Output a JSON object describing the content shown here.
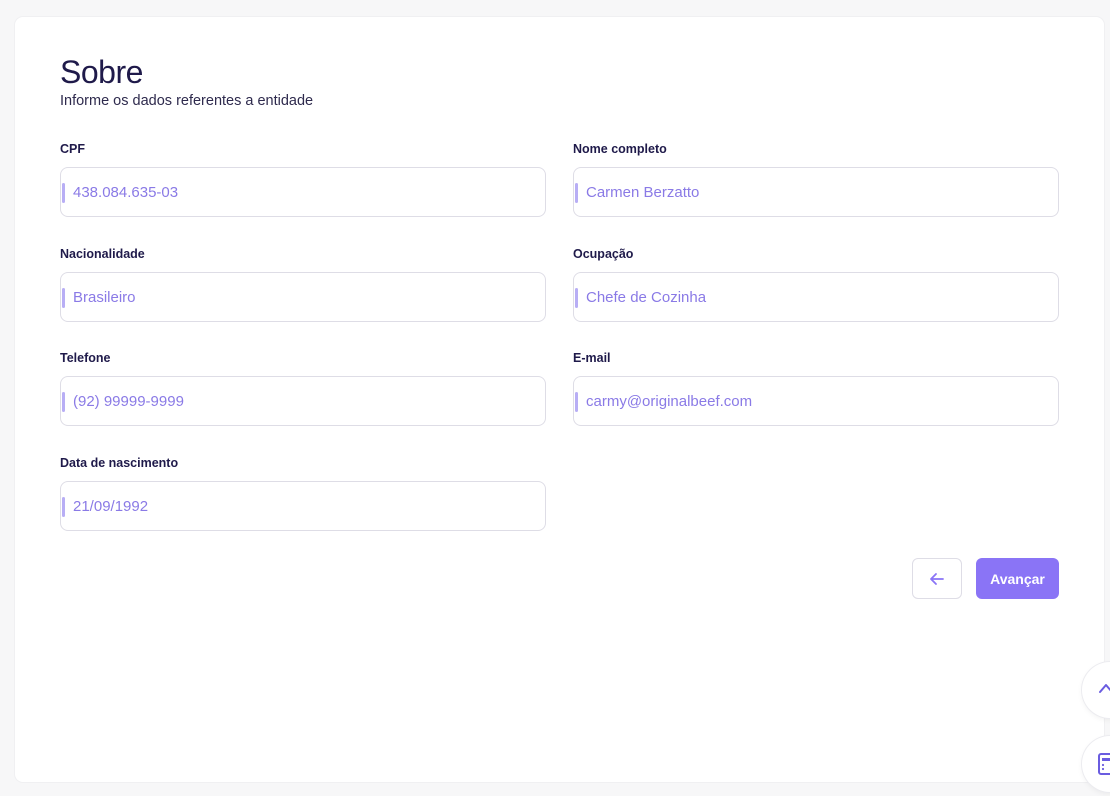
{
  "header": {
    "title": "Sobre",
    "subtitle": "Informe os dados referentes a entidade"
  },
  "fields": {
    "cpf": {
      "label": "CPF",
      "value": "438.084.635-03"
    },
    "name": {
      "label": "Nome completo",
      "value": "Carmen Berzatto"
    },
    "nationality": {
      "label": "Nacionalidade",
      "value": "Brasileiro"
    },
    "occupation": {
      "label": "Ocupação",
      "value": "Chefe de Cozinha"
    },
    "phone": {
      "label": "Telefone",
      "value": "(92) 99999-9999"
    },
    "email": {
      "label": "E-mail",
      "value": "carmy@originalbeef.com"
    },
    "birthdate": {
      "label": "Data de nascimento",
      "value": "21/09/1992"
    }
  },
  "actions": {
    "back_icon": "arrow-left-icon",
    "next_label": "Avançar"
  },
  "floating": {
    "top_icon": "chevron-up-icon",
    "bottom_icon": "calculator-icon"
  },
  "colors": {
    "accent": "#8a74f6",
    "value_text": "#8a7ae6",
    "heading": "#1f1a4a"
  }
}
